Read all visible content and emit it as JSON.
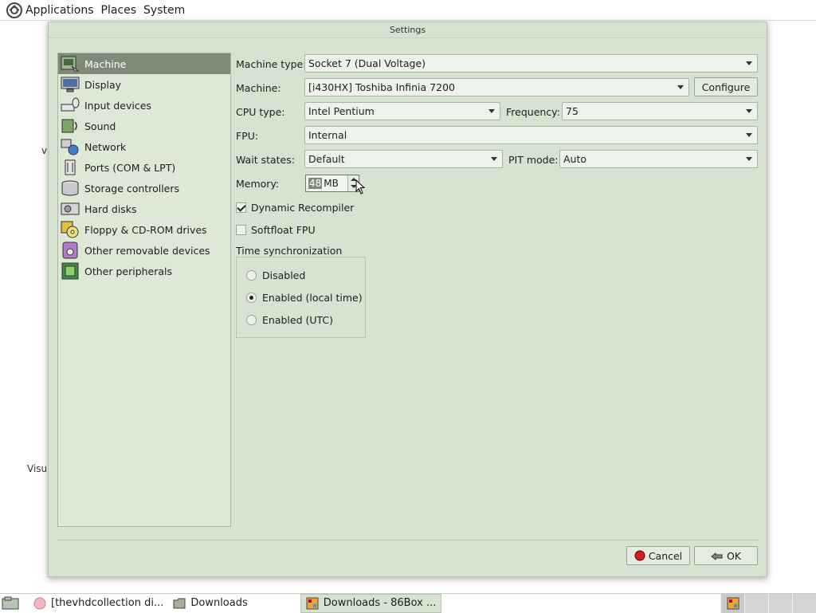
{
  "top_panel": {
    "menus": [
      "Applications",
      "Places",
      "System"
    ],
    "logo_icon": "distro-logo-icon"
  },
  "desktop": {
    "fragment_1": "vi",
    "fragment_2": "Visu"
  },
  "window": {
    "title": "Settings"
  },
  "sidebar": {
    "items": [
      {
        "label": "Machine",
        "icon": "machine-icon",
        "active": true
      },
      {
        "label": "Display",
        "icon": "display-icon",
        "active": false
      },
      {
        "label": "Input devices",
        "icon": "input-devices-icon",
        "active": false
      },
      {
        "label": "Sound",
        "icon": "sound-icon",
        "active": false
      },
      {
        "label": "Network",
        "icon": "network-icon",
        "active": false
      },
      {
        "label": "Ports (COM & LPT)",
        "icon": "ports-icon",
        "active": false
      },
      {
        "label": "Storage controllers",
        "icon": "storage-icon",
        "active": false
      },
      {
        "label": "Hard disks",
        "icon": "hard-disk-icon",
        "active": false
      },
      {
        "label": "Floppy & CD-ROM drives",
        "icon": "floppy-cdrom-icon",
        "active": false
      },
      {
        "label": "Other removable devices",
        "icon": "removable-icon",
        "active": false
      },
      {
        "label": "Other peripherals",
        "icon": "peripherals-icon",
        "active": false
      }
    ]
  },
  "machine": {
    "machine_type_label": "Machine type:",
    "machine_type_value": "Socket 7 (Dual Voltage)",
    "machine_label": "Machine:",
    "machine_value": "[i430HX] Toshiba Infinia 7200",
    "configure_label": "Configure",
    "cpu_type_label": "CPU type:",
    "cpu_type_value": "Intel Pentium",
    "frequency_label": "Frequency:",
    "frequency_value": "75",
    "fpu_label": "FPU:",
    "fpu_value": "Internal",
    "wait_states_label": "Wait states:",
    "wait_states_value": "Default",
    "pit_mode_label": "PIT mode:",
    "pit_mode_value": "Auto",
    "memory_label": "Memory:",
    "memory_value": "48",
    "memory_unit": "MB",
    "dynamic_recompiler_label": "Dynamic Recompiler",
    "dynamic_recompiler_checked": true,
    "softfloat_label": "Softfloat FPU",
    "softfloat_checked": false,
    "time_sync_label": "Time synchronization",
    "time_sync_options": [
      {
        "label": "Disabled",
        "selected": false
      },
      {
        "label": "Enabled (local time)",
        "selected": true
      },
      {
        "label": "Enabled (UTC)",
        "selected": false
      }
    ]
  },
  "footer": {
    "cancel_label": "Cancel",
    "ok_label": "OK"
  },
  "taskbar": {
    "tasks": [
      {
        "label": "[thevhdcollection di...",
        "icon": "browser-icon"
      },
      {
        "label": "Downloads",
        "icon": "folder-icon"
      },
      {
        "label": "Downloads - 86Box ...",
        "icon": "86box-icon"
      }
    ]
  }
}
